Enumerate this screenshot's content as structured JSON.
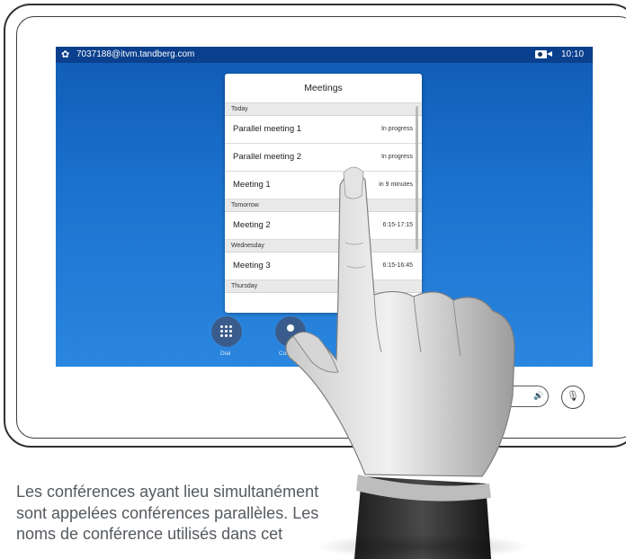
{
  "status_bar": {
    "account": "7037188@itvm.tandberg.com",
    "time": "10:10",
    "settings_icon": "gear-icon",
    "camera_icon": "camera-icon"
  },
  "meetings_panel": {
    "title": "Meetings",
    "sections": [
      {
        "label": "Today",
        "items": [
          {
            "title": "Parallel meeting 1",
            "status": "In progress"
          },
          {
            "title": "Parallel meeting 2",
            "status": "In progress"
          },
          {
            "title": "Meeting 1",
            "status": "in 9 minutes"
          }
        ]
      },
      {
        "label": "Tomorrow",
        "items": [
          {
            "title": "Meeting 2",
            "status": "6:15-17:15"
          }
        ]
      },
      {
        "label": "Wednesday",
        "items": [
          {
            "title": "Meeting 3",
            "status": "6:15-16:45"
          }
        ]
      },
      {
        "label": "Thursday",
        "items": []
      }
    ]
  },
  "call_buttons": {
    "dial_label": "Dial",
    "contacts_label": "Cont"
  },
  "controls": {
    "volume_icon": "speaker-icon",
    "mute_icon": "microphone-muted-icon"
  },
  "caption": {
    "text": "Les conférences ayant lieu simultanément sont appelées conférences parallèles. Les noms de conférence utilisés dans cet"
  },
  "colors": {
    "screen_background": "#1c73cf",
    "status_bar": "#0a3a8a",
    "button_background": "#3a5c8c"
  }
}
